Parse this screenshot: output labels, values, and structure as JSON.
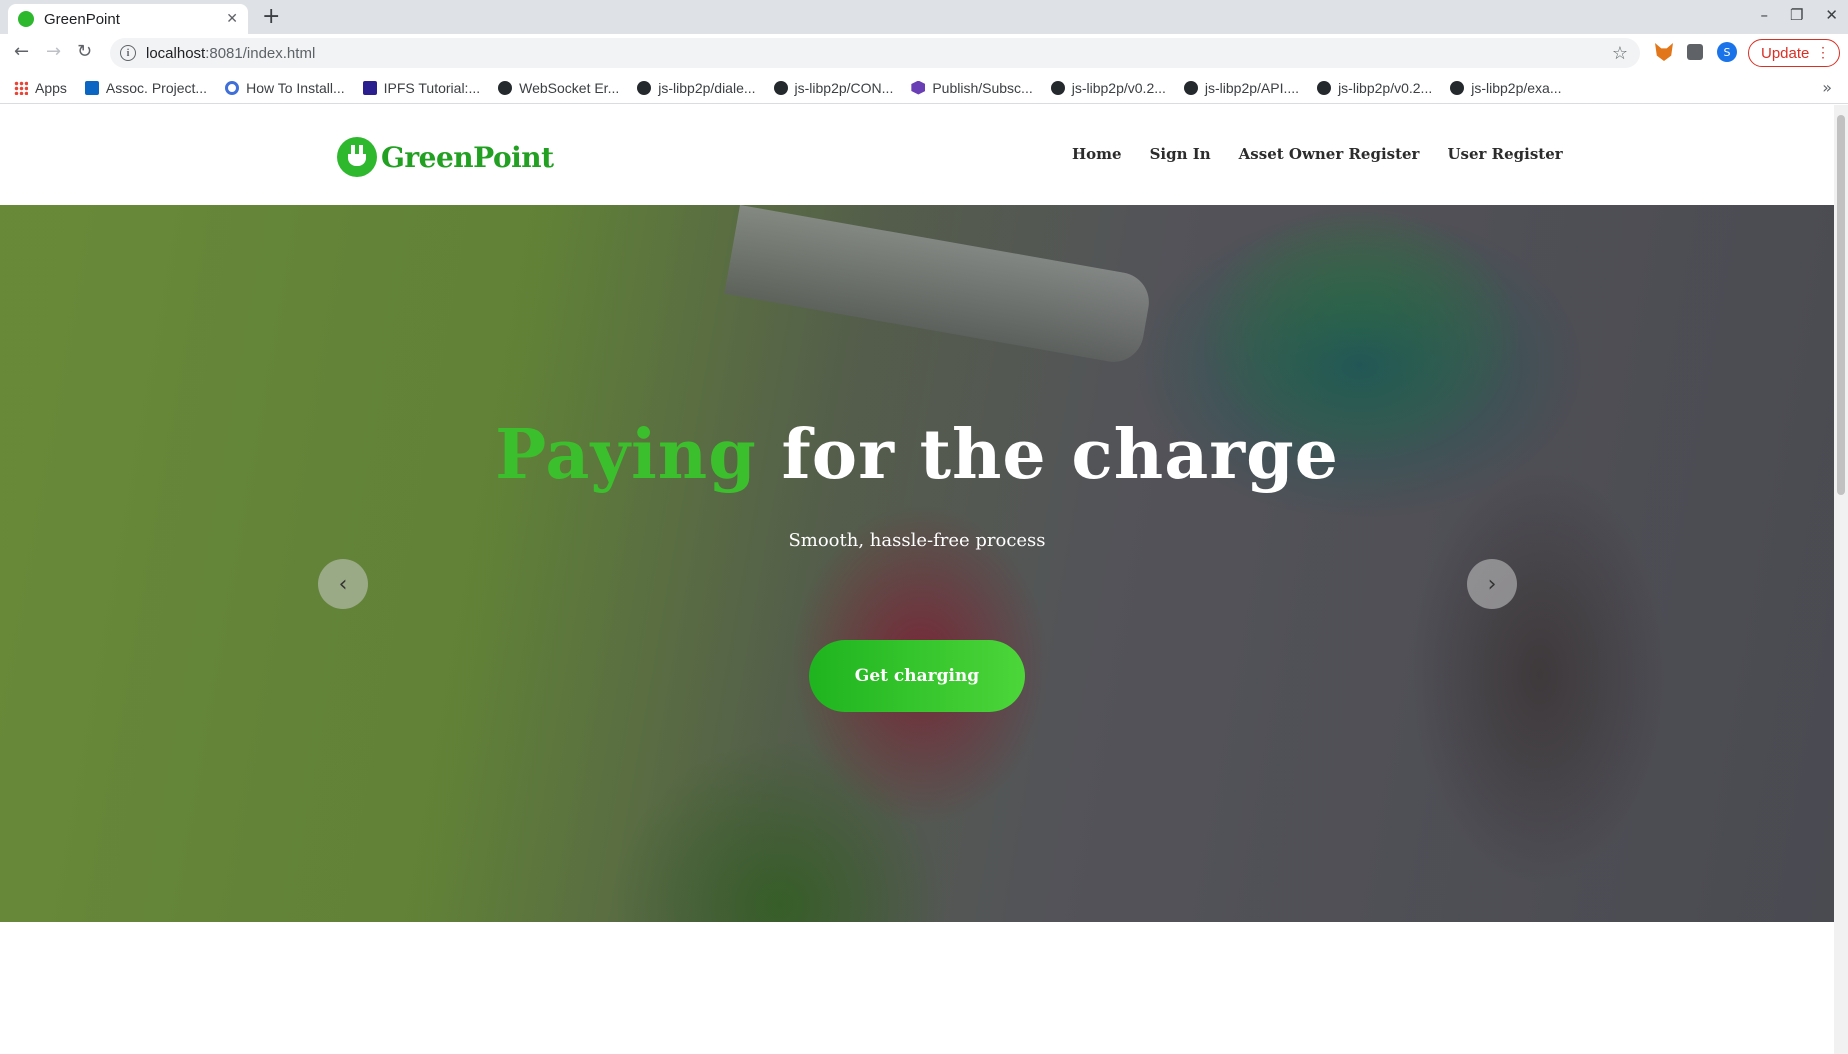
{
  "browser": {
    "tab_title": "GreenPoint",
    "new_tab_glyph": "+",
    "close_glyph": "✕",
    "url_host": "localhost",
    "url_path": ":8081/index.html",
    "update_label": "Update",
    "bookmarks": [
      {
        "label": "Apps",
        "icon": "apps-icon"
      },
      {
        "label": "Assoc. Project...",
        "icon": "linkedin-icon"
      },
      {
        "label": "How To Install...",
        "icon": "ring-icon"
      },
      {
        "label": "IPFS Tutorial:...",
        "icon": "edureka-icon"
      },
      {
        "label": "WebSocket Er...",
        "icon": "github-icon"
      },
      {
        "label": "js-libp2p/diale...",
        "icon": "github-icon"
      },
      {
        "label": "js-libp2p/CON...",
        "icon": "github-icon"
      },
      {
        "label": "Publish/Subsc...",
        "icon": "hex-icon"
      },
      {
        "label": "js-libp2p/v0.2...",
        "icon": "github-icon"
      },
      {
        "label": "js-libp2p/API....",
        "icon": "github-icon"
      },
      {
        "label": "js-libp2p/v0.2...",
        "icon": "github-icon"
      },
      {
        "label": "js-libp2p/exa...",
        "icon": "github-icon"
      }
    ],
    "profile_initial": "S"
  },
  "site": {
    "logo_text": "GreenPoint",
    "nav": [
      "Home",
      "Sign In",
      "Asset Owner Register",
      "User Register"
    ]
  },
  "hero": {
    "title_accent": "Paying",
    "title_rest": " for the charge",
    "subtitle": "Smooth, hassle-free process",
    "cta_label": "Get charging",
    "prev_glyph": "‹",
    "next_glyph": "›"
  },
  "colors": {
    "brand_green": "#2eb82e",
    "accent_green": "#3cbf2c",
    "update_red": "#d93025"
  }
}
